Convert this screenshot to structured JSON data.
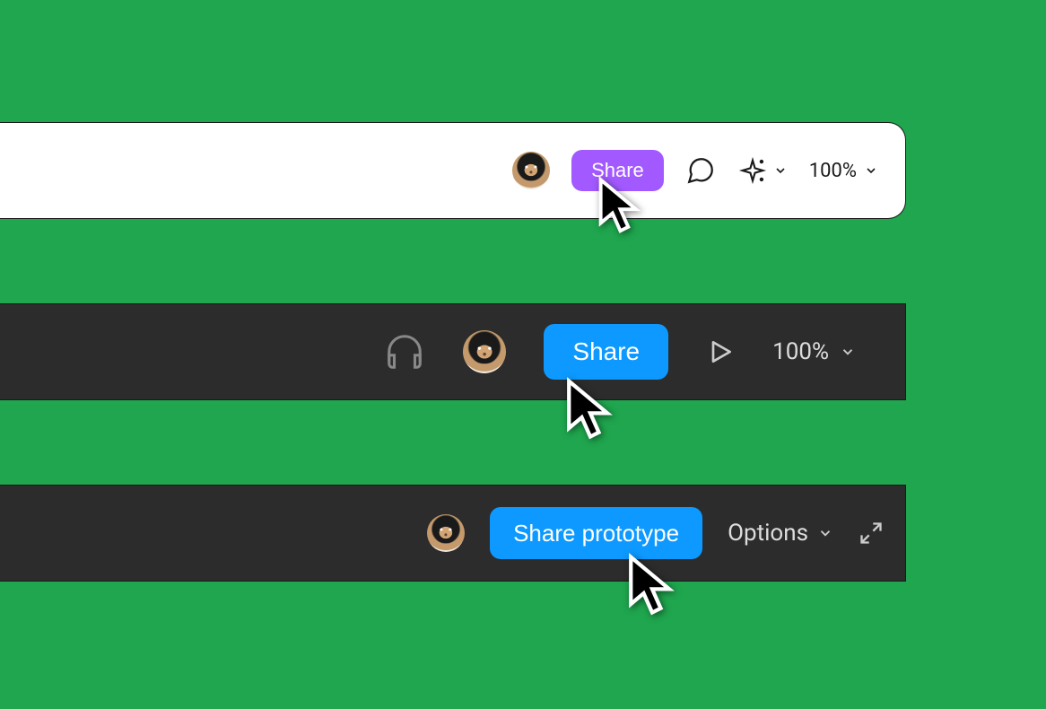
{
  "toolbar1": {
    "share_label": "Share",
    "zoom_label": "100%"
  },
  "toolbar2": {
    "share_label": "Share",
    "zoom_label": "100%"
  },
  "toolbar3": {
    "share_label": "Share prototype",
    "options_label": "Options"
  },
  "colors": {
    "background": "#1fa64e",
    "purple": "#a259ff",
    "blue": "#0d99ff",
    "dark_bar": "#2c2c2c"
  }
}
